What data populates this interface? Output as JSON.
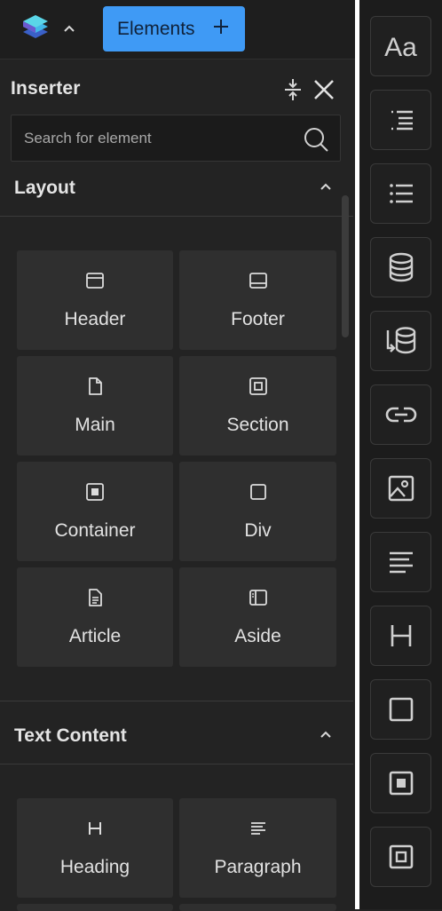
{
  "header": {
    "tab_label": "Elements"
  },
  "inserter": {
    "title": "Inserter",
    "search_placeholder": "Search for element"
  },
  "sections": {
    "layout": {
      "title": "Layout",
      "items": [
        {
          "label": "Header",
          "icon": "header-icon"
        },
        {
          "label": "Footer",
          "icon": "footer-icon"
        },
        {
          "label": "Main",
          "icon": "main-icon"
        },
        {
          "label": "Section",
          "icon": "section-icon"
        },
        {
          "label": "Container",
          "icon": "container-icon"
        },
        {
          "label": "Div",
          "icon": "div-icon"
        },
        {
          "label": "Article",
          "icon": "article-icon"
        },
        {
          "label": "Aside",
          "icon": "aside-icon"
        }
      ]
    },
    "text_content": {
      "title": "Text Content",
      "items": [
        {
          "label": "Heading",
          "icon": "heading-icon"
        },
        {
          "label": "Paragraph",
          "icon": "paragraph-icon"
        }
      ]
    }
  },
  "rail": {
    "text_icon": "Aa",
    "items": [
      "text-icon",
      "nested-list-icon",
      "list-icon",
      "database-icon",
      "database-import-icon",
      "link-icon",
      "image-icon",
      "paragraph-icon",
      "heading-icon",
      "div-icon",
      "container-icon",
      "section-icon"
    ]
  },
  "colors": {
    "accent": "#3f9af5",
    "panel": "#232323",
    "tile": "#2f2f2f",
    "rail": "#1c1c1c"
  }
}
